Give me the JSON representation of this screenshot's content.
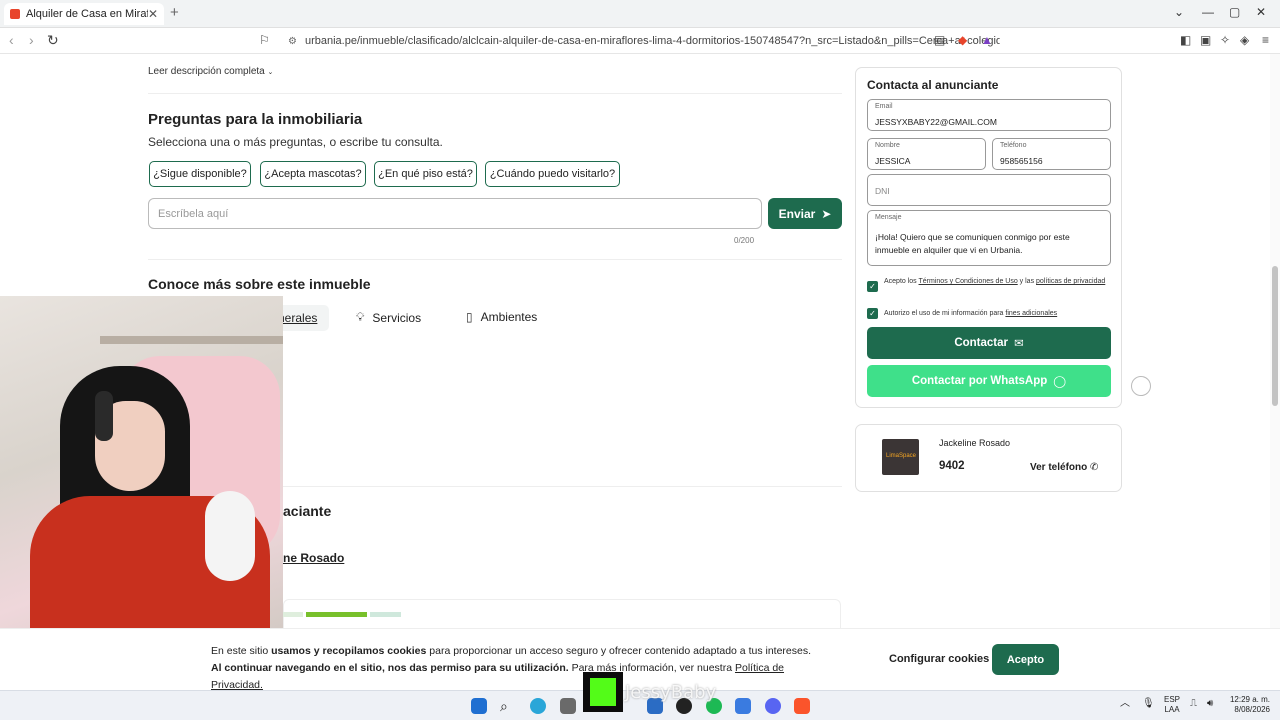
{
  "browser": {
    "tab_title": "Alquiler de Casa en Miraflores",
    "new_tab": "+",
    "url": "urbania.pe/inmueble/clasificado/alclcain-alquiler-de-casa-en-miraflores-lima-4-dormitorios-150748547?n_src=Listado&n_pills=Cerca+a+colegios&n..."
  },
  "page": {
    "leer_descripcion": "Leer descripción completa",
    "preguntas_title": "Preguntas para la inmobiliaria",
    "preguntas_sub": "Selecciona una o más preguntas, o escribe tu consulta.",
    "chips": [
      "¿Sigue disponible?",
      "¿Acepta mascotas?",
      "¿En qué piso está?",
      "¿Cuándo puedo visitarlo?"
    ],
    "message_placeholder": "Escríbela aquí",
    "send_label": "Enviar",
    "counter": "0/200",
    "conoce_title": "Conoce más sobre este inmueble",
    "tabs": [
      "Generales",
      "Servicios",
      "Ambientes"
    ],
    "anunciante_title_partial": "aciante",
    "anunciante_name_partial": "ne Rosado"
  },
  "contact": {
    "title": "Contacta al anunciante",
    "email_label": "Email",
    "email_value": "JESSYXBABY22@GMAIL.COM",
    "nombre_label": "Nombre",
    "nombre_value": "JESSICA",
    "telefono_label": "Teléfono",
    "telefono_value": "958565156",
    "dni_placeholder": "DNI",
    "mensaje_label": "Mensaje",
    "mensaje_value": "¡Hola! Quiero que se comuniquen conmigo por este inmueble en alquiler que vi en Urbania.",
    "check1_a": "Acepto los ",
    "check1_link1": "Términos y Condiciones de Uso",
    "check1_b": " y las ",
    "check1_link2": "políticas de privacidad",
    "check2_a": "Autorizo el uso de mi información para ",
    "check2_link": "fines adicionales",
    "contactar_label": "Contactar",
    "whatsapp_label": "Contactar por WhatsApp"
  },
  "agent": {
    "name": "Jackeline Rosado",
    "phone_partial": "9402",
    "ver_telefono": "Ver teléfono",
    "logo_text": "LimaSpace"
  },
  "cookie": {
    "text_1": "En este sitio ",
    "text_bold1": "usamos y recopilamos cookies",
    "text_2": " para proporcionar un acceso seguro y ofrecer contenido adaptado a tus intereses. ",
    "text_bold2": "Al continuar navegando en el sitio, nos das permiso para su utilización.",
    "text_3": " Para más información, ver nuestra ",
    "text_link": "Política de Privacidad.",
    "configurar": "Configurar cookies",
    "acepto": "Acepto"
  },
  "stream": {
    "overlay_name": "JessyBaby"
  },
  "taskbar": {
    "lang_1": "ESP",
    "lang_2": "LAA",
    "time": "12:29 a. m.",
    "date": "8/08/2026"
  },
  "colors": {
    "brand_green": "#1e6b4e",
    "whatsapp_green": "#3fe08a"
  }
}
